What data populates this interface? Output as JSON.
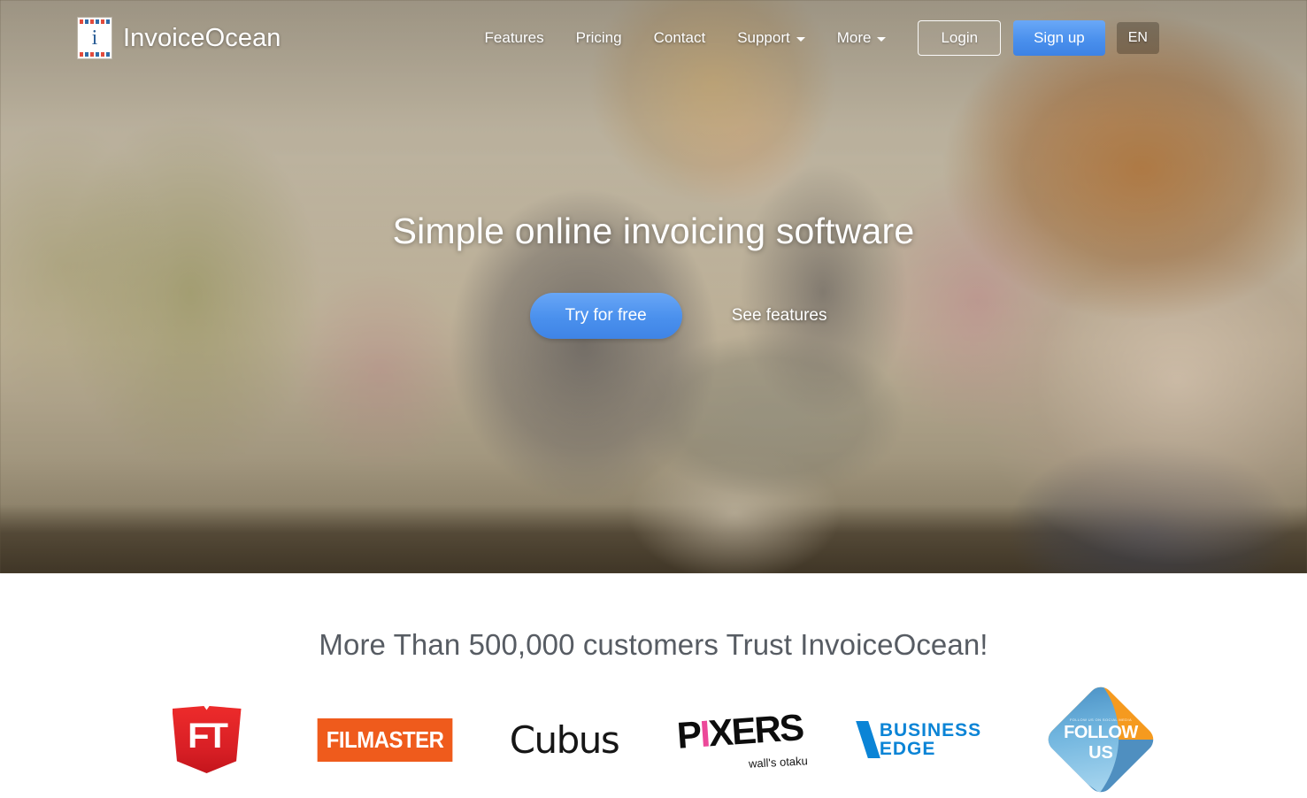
{
  "brand": {
    "name": "InvoiceOcean",
    "mark_letter": "i"
  },
  "nav": {
    "links": [
      {
        "label": "Features",
        "has_caret": false
      },
      {
        "label": "Pricing",
        "has_caret": false
      },
      {
        "label": "Contact",
        "has_caret": false
      },
      {
        "label": "Support",
        "has_caret": true
      },
      {
        "label": "More",
        "has_caret": true
      }
    ],
    "login_label": "Login",
    "signup_label": "Sign up",
    "language": "EN"
  },
  "hero": {
    "title": "Simple online invoicing software",
    "primary_cta": "Try for free",
    "secondary_cta": "See features"
  },
  "customers": {
    "title": "More Than 500,000 customers Trust InvoiceOcean!",
    "logos": [
      {
        "name": "FT",
        "text": "FT"
      },
      {
        "name": "Filmaster",
        "text": "FILMASTER"
      },
      {
        "name": "Cubus",
        "text": "Cubus"
      },
      {
        "name": "Pixers",
        "text_before": "P",
        "text_i": "I",
        "text_after": "XERS",
        "tagline": "wall's otaku"
      },
      {
        "name": "Business Edge",
        "line1": "BUSINESS",
        "line2": "EDGE"
      },
      {
        "name": "Follow Us",
        "tiny": "FOLLOW US ON SOCIAL MEDIA",
        "line1": "FOLLOW",
        "line2": "US"
      }
    ]
  },
  "colors": {
    "accent_blue": "#4a90ed",
    "heading_gray": "#575c63",
    "filmaster_orange": "#ef5b1c",
    "ft_red": "#d81f25",
    "pixers_pink": "#ec4899",
    "business_edge_blue": "#0b84d6",
    "follow_orange": "#f59a1f",
    "follow_blue": "#4f8fc0"
  }
}
